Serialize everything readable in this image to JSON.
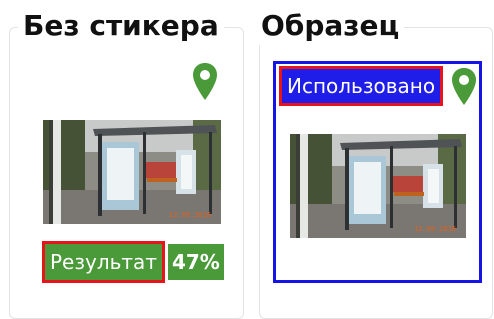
{
  "left_panel": {
    "title": "Без стикера",
    "pin_icon": "map-pin-icon",
    "result_label": "Результат",
    "result_score": "47%"
  },
  "right_panel": {
    "title": "Образец",
    "pin_icon": "map-pin-icon",
    "used_label": "Использовано"
  },
  "colors": {
    "pin_green": "#4a9a39",
    "badge_green": "#4a9a39",
    "highlight_red": "#e8141b",
    "selection_blue": "#1414e6"
  }
}
